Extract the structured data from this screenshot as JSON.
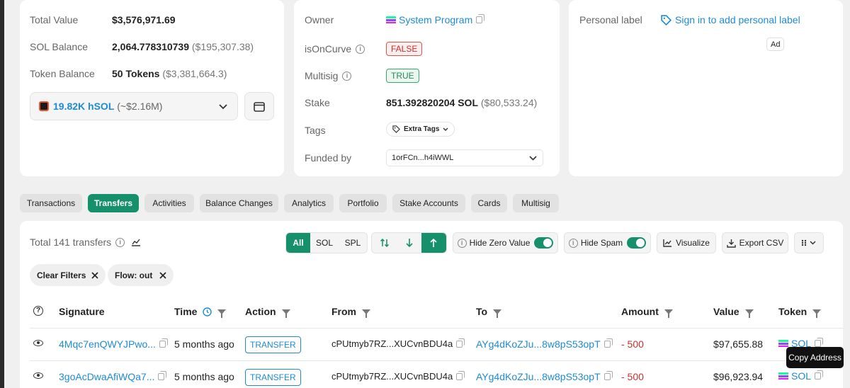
{
  "overview": {
    "total_value_label": "Total Value",
    "total_value": "$3,576,971.69",
    "sol_balance_label": "SOL Balance",
    "sol_balance": "2,064.778310739",
    "sol_balance_usd": "($195,307.38)",
    "token_balance_label": "Token Balance",
    "token_balance": "50 Tokens",
    "token_balance_usd": "($3,381,664.3)",
    "token_select_value": "19.82K hSOL",
    "token_select_usd": "(~$2.16M)"
  },
  "info": {
    "owner_label": "Owner",
    "owner_value": "System Program",
    "isoncurve_label": "isOnCurve",
    "isoncurve_value": "FALSE",
    "multisig_label": "Multisig",
    "multisig_value": "TRUE",
    "stake_label": "Stake",
    "stake_value": "851.392820204 SOL",
    "stake_usd": "($80,533.24)",
    "tags_label": "Tags",
    "tags_button": "Extra Tags",
    "funded_label": "Funded by",
    "funded_value": "1orFCn...h4iWWL"
  },
  "personal": {
    "label": "Personal label",
    "link": "Sign in to add personal label",
    "ad": "Ad"
  },
  "tabs": [
    "Transactions",
    "Transfers",
    "Activities",
    "Balance Changes",
    "Analytics",
    "Portfolio",
    "Stake Accounts",
    "Cards",
    "Multisig"
  ],
  "toolbar": {
    "total": "Total 141 transfers",
    "all": "All",
    "sol": "SOL",
    "spl": "SPL",
    "hide_zero": "Hide Zero Value",
    "hide_spam": "Hide Spam",
    "visualize": "Visualize",
    "export": "Export CSV"
  },
  "filters": {
    "clear": "Clear Filters",
    "flow": "Flow: out"
  },
  "table": {
    "headers": {
      "signature": "Signature",
      "time": "Time",
      "action": "Action",
      "from": "From",
      "to": "To",
      "amount": "Amount",
      "value": "Value",
      "token": "Token"
    },
    "rows": [
      {
        "signature": "4Mqc7enQWYJPwo...",
        "time": "5 months ago",
        "action": "TRANSFER",
        "from": "cPUtmyb7RZ...XUCvnBDU4a",
        "to": "AYg4dKoZJu...8w8pS53opT",
        "amount": "- 500",
        "value": "$97,655.88",
        "token": "SOL"
      },
      {
        "signature": "3goAcDwaAfiWQa7...",
        "time": "5 months ago",
        "action": "TRANSFER",
        "from": "cPUtmyb7RZ...XUCvnBDU4a",
        "to": "AYg4dKoZJu...8w8pS53opT",
        "amount": "- 500",
        "value": "$96,923.94",
        "token": "SOL"
      }
    ]
  },
  "tooltip": "Copy Address",
  "colors": {
    "accent": "#16906a",
    "link": "#1e8bd6",
    "negative": "#c9302c"
  }
}
